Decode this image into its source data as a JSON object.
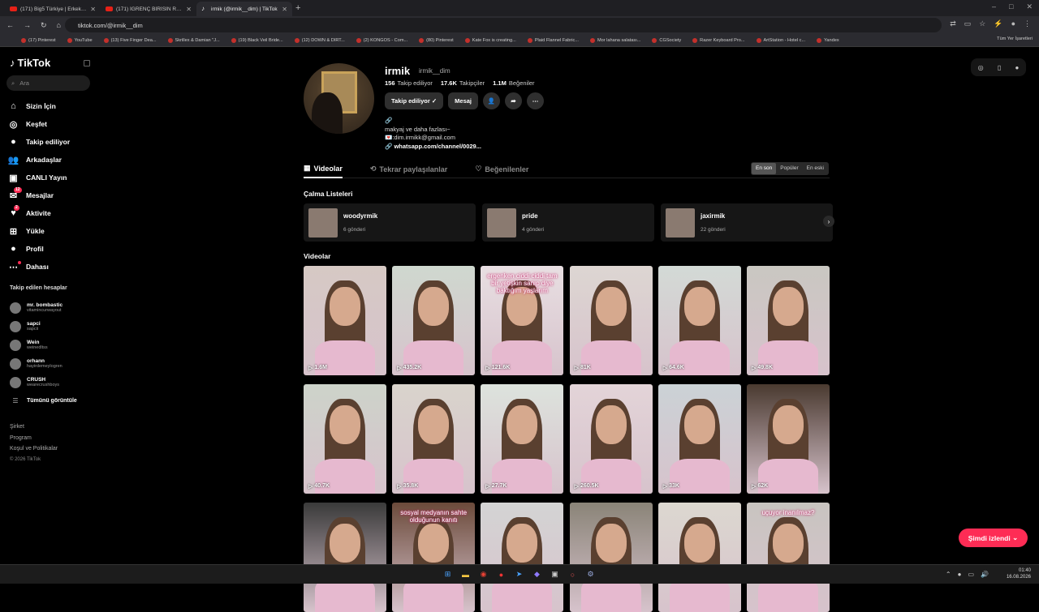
{
  "browser": {
    "tabs": [
      {
        "title": "(171) Big5 Türkiye | Erkek Hazır",
        "icon": "youtube-icon"
      },
      {
        "title": "(171) İĞRENÇ BİRİSİN RENGİN",
        "icon": "youtube-icon"
      },
      {
        "title": "irmik (@irmik__dim) | TikTok",
        "icon": "tiktok-icon"
      }
    ],
    "url": "tiktok.com/@irmik__dim",
    "bookmarks": [
      "(17) Pinterest",
      "YouTube",
      "(13) Five Finger Dea...",
      "Skrillex & Damian \"J...",
      "(19) Black Veil Bride...",
      "(12) DOWN & DIRT...",
      "(2) KONGOS - Com...",
      "(80) Pinterest",
      "Kate Fox is creating...",
      "Plaid Flannel Fabric...",
      "Mor lahana salatası...",
      "CGSociety",
      "Razer Keyboard Pro...",
      "ArtStation - Hotel c...",
      "Yandex"
    ],
    "bookmarks_right": "Tüm Yer İşaretleri"
  },
  "sidebar": {
    "logo": "TikTok",
    "search_placeholder": "Ara",
    "nav": [
      {
        "label": "Sizin İçin",
        "icon": "home-icon"
      },
      {
        "label": "Keşfet",
        "icon": "compass-icon"
      },
      {
        "label": "Takip ediliyor",
        "icon": "following-avatar-icon"
      },
      {
        "label": "Arkadaşlar",
        "icon": "friends-icon"
      },
      {
        "label": "CANLI Yayın",
        "icon": "live-icon"
      },
      {
        "label": "Mesajlar",
        "icon": "messages-icon",
        "badge": "12"
      },
      {
        "label": "Aktivite",
        "icon": "activity-icon",
        "badge": "2"
      },
      {
        "label": "Yükle",
        "icon": "upload-icon"
      },
      {
        "label": "Profil",
        "icon": "profile-avatar-icon"
      },
      {
        "label": "Dahası",
        "icon": "more-icon"
      }
    ],
    "following_title": "Takip edilen hesaplar",
    "following": [
      {
        "name": "mr. bombastic",
        "user": "vitamincurwayout"
      },
      {
        "name": "sapci",
        "user": "sapcii"
      },
      {
        "name": "Wein",
        "user": "weinedltss"
      },
      {
        "name": "orhann",
        "user": "hayirdemeylogren"
      },
      {
        "name": "CRUSH",
        "user": "wearecrushboys"
      }
    ],
    "see_all": "Tümünü görüntüle",
    "footer": [
      "Şirket",
      "Program",
      "Koşul ve Politikalar"
    ],
    "copyright": "© 2026 TikTok"
  },
  "profile": {
    "name": "irmik",
    "username": "irmik__dim",
    "following_count": "156",
    "following_label": "Takip ediliyor",
    "followers_count": "17.6K",
    "followers_label": "Takipçiler",
    "likes_count": "1.1M",
    "likes_label": "Beğeniler",
    "follow_btn": "Takip ediliyor ✓",
    "message_btn": "Mesaj",
    "bio1": "makyaj ve daha fazlası~",
    "bio2": "💌:dim.irmikk@gmail.com",
    "link": "whatsapp.com/channel/0029..."
  },
  "tabs": [
    "Videolar",
    "Tekrar paylaşılanlar",
    "Beğenilenler"
  ],
  "sort": [
    "En son",
    "Popüler",
    "En eski"
  ],
  "playlists_title": "Çalma Listeleri",
  "playlists": [
    {
      "name": "woodyrmik",
      "count": "6 gönderi"
    },
    {
      "name": "pride",
      "count": "4 gönderi"
    },
    {
      "name": "jaxirmik",
      "count": "22 gönderi"
    }
  ],
  "videos_title": "Videolar",
  "videos": [
    {
      "views": "1.6M"
    },
    {
      "views": "435.2K"
    },
    {
      "views": "121.6K",
      "caption": "ergenken ciddi ciddi tam bir yetişkin sanıp diye baktığım yaşlarım"
    },
    {
      "views": "81K"
    },
    {
      "views": "64.6K"
    },
    {
      "views": "49.8K"
    },
    {
      "views": "40.7K"
    },
    {
      "views": "35.8K"
    },
    {
      "views": "27.7K"
    },
    {
      "views": "260.5K"
    },
    {
      "views": "33K"
    },
    {
      "views": "62K"
    },
    {
      "views": ""
    },
    {
      "views": "",
      "caption": "sosyal medyanın sahte olduğunun kanıtı"
    },
    {
      "views": ""
    },
    {
      "views": ""
    },
    {
      "views": ""
    },
    {
      "views": "",
      "caption": "uçuyor inanılmaz?"
    }
  ],
  "watch_now": "Şimdi izlendi",
  "clock": {
    "time": "01:40",
    "date": "16.08.2026"
  },
  "colors": {
    "accent": "#fe2c55",
    "bg": "#000000"
  }
}
